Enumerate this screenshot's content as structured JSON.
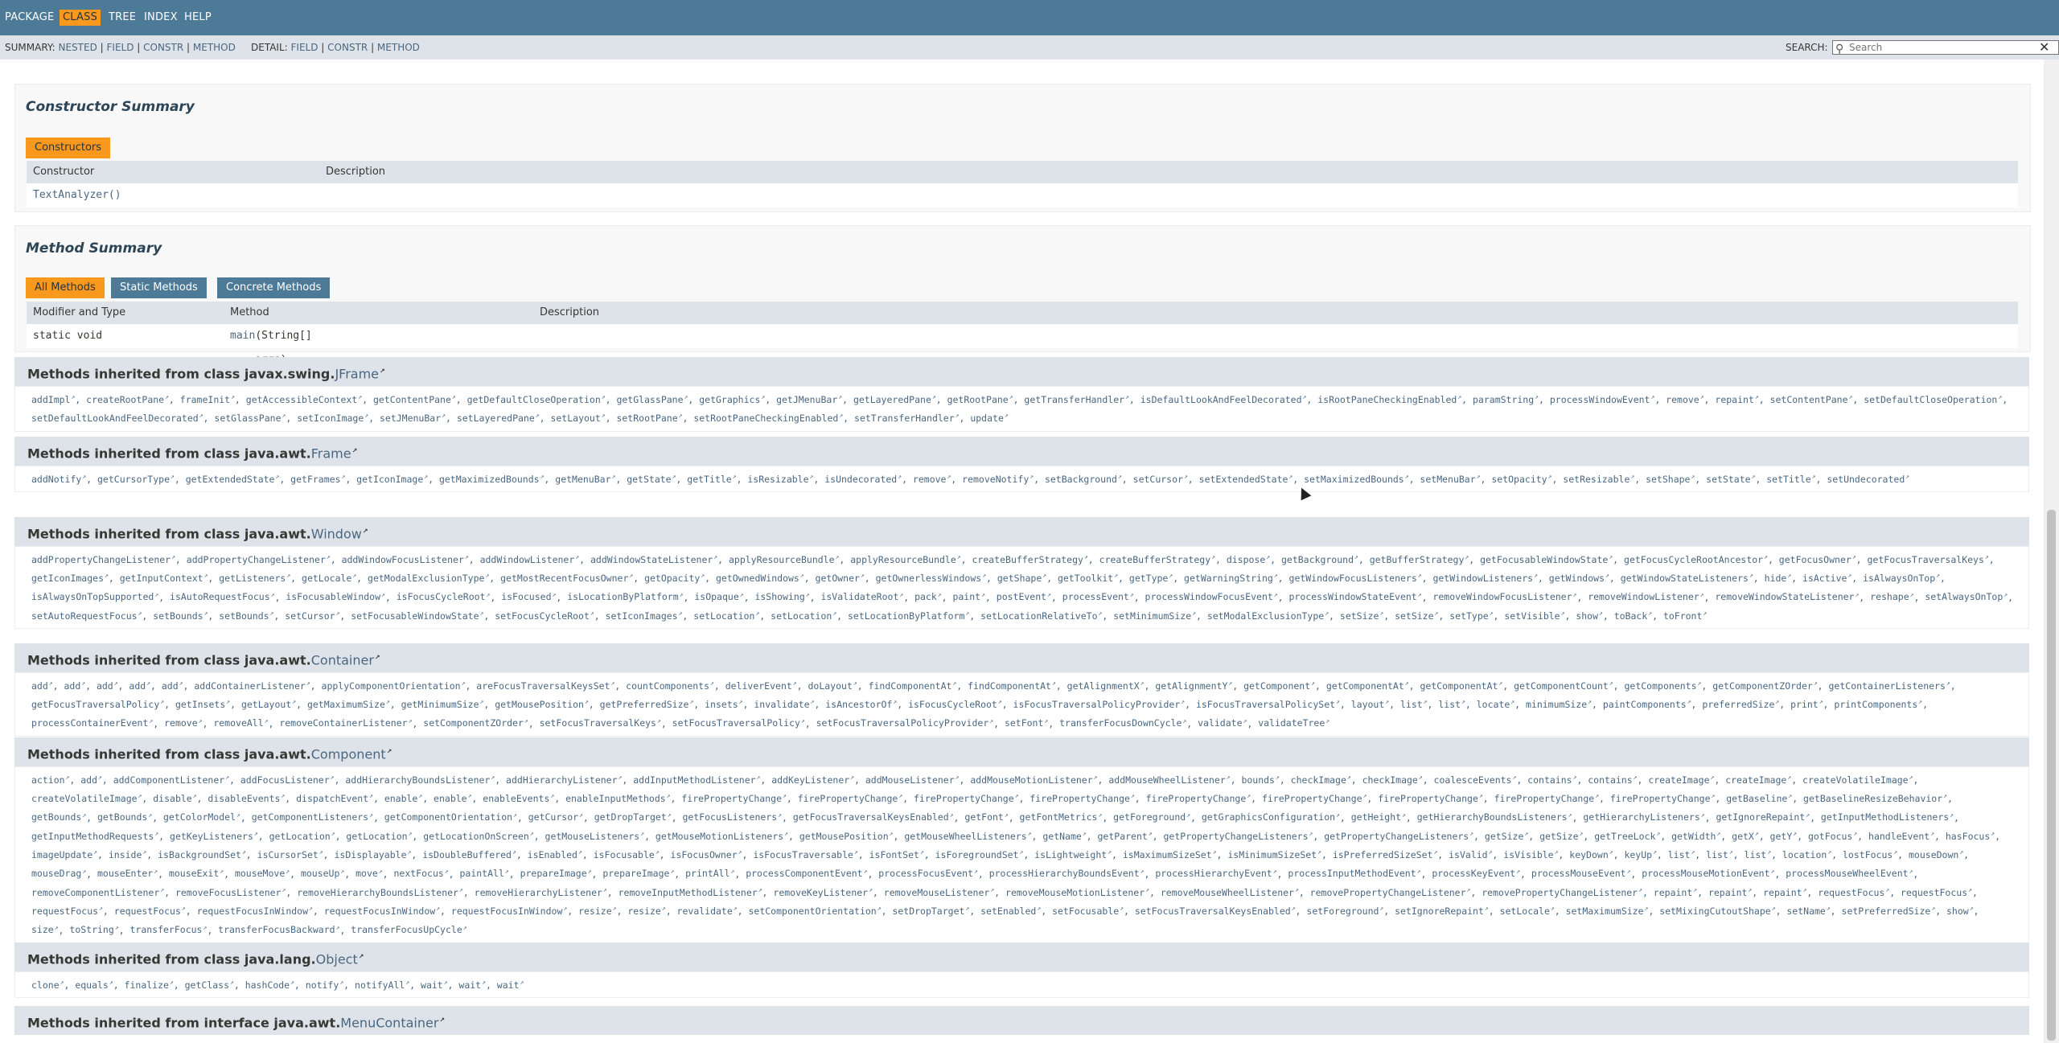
{
  "topnav": {
    "items": [
      "PACKAGE",
      "CLASS",
      "TREE",
      "INDEX",
      "HELP"
    ],
    "active": "CLASS"
  },
  "subnav": {
    "summary_label": "SUMMARY:",
    "summary_items": [
      "NESTED",
      "FIELD",
      "CONSTR",
      "METHOD"
    ],
    "detail_label": "DETAIL:",
    "detail_items": [
      "FIELD",
      "CONSTR",
      "METHOD"
    ],
    "search_label": "SEARCH:",
    "search_placeholder": "Search"
  },
  "constructor_summary": {
    "title": "Constructor Summary",
    "tab": "Constructors",
    "col_constructor": "Constructor",
    "col_description": "Description",
    "row_constructor": "TextAnalyzer()"
  },
  "method_summary": {
    "title": "Method Summary",
    "tabs": [
      "All Methods",
      "Static Methods",
      "Concrete Methods"
    ],
    "col_modifier": "Modifier and Type",
    "col_method": "Method",
    "col_description": "Description",
    "row_modifier": "static void",
    "row_method_name": "main",
    "row_method_params": "(String[] args)"
  },
  "inherited": [
    {
      "prefix": "Methods inherited from class javax.swing.",
      "cls": "JFrame",
      "methods": [
        "addImpl",
        "createRootPane",
        "frameInit",
        "getAccessibleContext",
        "getContentPane",
        "getDefaultCloseOperation",
        "getGlassPane",
        "getGraphics",
        "getJMenuBar",
        "getLayeredPane",
        "getRootPane",
        "getTransferHandler",
        "isDefaultLookAndFeelDecorated",
        "isRootPaneCheckingEnabled",
        "paramString",
        "processWindowEvent",
        "remove",
        "repaint",
        "setContentPane",
        "setDefaultCloseOperation",
        "setDefaultLookAndFeelDecorated",
        "setGlassPane",
        "setIconImage",
        "setJMenuBar",
        "setLayeredPane",
        "setLayout",
        "setRootPane",
        "setRootPaneCheckingEnabled",
        "setTransferHandler",
        "update"
      ]
    },
    {
      "prefix": "Methods inherited from class java.awt.",
      "cls": "Frame",
      "methods": [
        "addNotify",
        "getCursorType",
        "getExtendedState",
        "getFrames",
        "getIconImage",
        "getMaximizedBounds",
        "getMenuBar",
        "getState",
        "getTitle",
        "isResizable",
        "isUndecorated",
        "remove",
        "removeNotify",
        "setBackground",
        "setCursor",
        "setExtendedState",
        "setMaximizedBounds",
        "setMenuBar",
        "setOpacity",
        "setResizable",
        "setShape",
        "setState",
        "setTitle",
        "setUndecorated"
      ]
    },
    {
      "prefix": "Methods inherited from class java.awt.",
      "cls": "Window",
      "methods": [
        "addPropertyChangeListener",
        "addPropertyChangeListener",
        "addWindowFocusListener",
        "addWindowListener",
        "addWindowStateListener",
        "applyResourceBundle",
        "applyResourceBundle",
        "createBufferStrategy",
        "createBufferStrategy",
        "dispose",
        "getBackground",
        "getBufferStrategy",
        "getFocusableWindowState",
        "getFocusCycleRootAncestor",
        "getFocusOwner",
        "getFocusTraversalKeys",
        "getIconImages",
        "getInputContext",
        "getListeners",
        "getLocale",
        "getModalExclusionType",
        "getMostRecentFocusOwner",
        "getOpacity",
        "getOwnedWindows",
        "getOwner",
        "getOwnerlessWindows",
        "getShape",
        "getToolkit",
        "getType",
        "getWarningString",
        "getWindowFocusListeners",
        "getWindowListeners",
        "getWindows",
        "getWindowStateListeners",
        "hide",
        "isActive",
        "isAlwaysOnTop",
        "isAlwaysOnTopSupported",
        "isAutoRequestFocus",
        "isFocusableWindow",
        "isFocusCycleRoot",
        "isFocused",
        "isLocationByPlatform",
        "isOpaque",
        "isShowing",
        "isValidateRoot",
        "pack",
        "paint",
        "postEvent",
        "processEvent",
        "processWindowFocusEvent",
        "processWindowStateEvent",
        "removeWindowFocusListener",
        "removeWindowListener",
        "removeWindowStateListener",
        "reshape",
        "setAlwaysOnTop",
        "setAutoRequestFocus",
        "setBounds",
        "setBounds",
        "setCursor",
        "setFocusableWindowState",
        "setFocusCycleRoot",
        "setIconImages",
        "setLocation",
        "setLocation",
        "setLocationByPlatform",
        "setLocationRelativeTo",
        "setMinimumSize",
        "setModalExclusionType",
        "setSize",
        "setSize",
        "setType",
        "setVisible",
        "show",
        "toBack",
        "toFront"
      ]
    },
    {
      "prefix": "Methods inherited from class java.awt.",
      "cls": "Container",
      "methods": [
        "add",
        "add",
        "add",
        "add",
        "add",
        "addContainerListener",
        "applyComponentOrientation",
        "areFocusTraversalKeysSet",
        "countComponents",
        "deliverEvent",
        "doLayout",
        "findComponentAt",
        "findComponentAt",
        "getAlignmentX",
        "getAlignmentY",
        "getComponent",
        "getComponentAt",
        "getComponentAt",
        "getComponentCount",
        "getComponents",
        "getComponentZOrder",
        "getContainerListeners",
        "getFocusTraversalPolicy",
        "getInsets",
        "getLayout",
        "getMaximumSize",
        "getMinimumSize",
        "getMousePosition",
        "getPreferredSize",
        "insets",
        "invalidate",
        "isAncestorOf",
        "isFocusCycleRoot",
        "isFocusTraversalPolicyProvider",
        "isFocusTraversalPolicySet",
        "layout",
        "list",
        "list",
        "locate",
        "minimumSize",
        "paintComponents",
        "preferredSize",
        "print",
        "printComponents",
        "processContainerEvent",
        "remove",
        "removeAll",
        "removeContainerListener",
        "setComponentZOrder",
        "setFocusTraversalKeys",
        "setFocusTraversalPolicy",
        "setFocusTraversalPolicyProvider",
        "setFont",
        "transferFocusDownCycle",
        "validate",
        "validateTree"
      ]
    },
    {
      "prefix": "Methods inherited from class java.awt.",
      "cls": "Component",
      "methods": [
        "action",
        "add",
        "addComponentListener",
        "addFocusListener",
        "addHierarchyBoundsListener",
        "addHierarchyListener",
        "addInputMethodListener",
        "addKeyListener",
        "addMouseListener",
        "addMouseMotionListener",
        "addMouseWheelListener",
        "bounds",
        "checkImage",
        "checkImage",
        "coalesceEvents",
        "contains",
        "contains",
        "createImage",
        "createImage",
        "createVolatileImage",
        "createVolatileImage",
        "disable",
        "disableEvents",
        "dispatchEvent",
        "enable",
        "enable",
        "enableEvents",
        "enableInputMethods",
        "firePropertyChange",
        "firePropertyChange",
        "firePropertyChange",
        "firePropertyChange",
        "firePropertyChange",
        "firePropertyChange",
        "firePropertyChange",
        "firePropertyChange",
        "firePropertyChange",
        "getBaseline",
        "getBaselineResizeBehavior",
        "getBounds",
        "getBounds",
        "getColorModel",
        "getComponentListeners",
        "getComponentOrientation",
        "getCursor",
        "getDropTarget",
        "getFocusListeners",
        "getFocusTraversalKeysEnabled",
        "getFont",
        "getFontMetrics",
        "getForeground",
        "getGraphicsConfiguration",
        "getHeight",
        "getHierarchyBoundsListeners",
        "getHierarchyListeners",
        "getIgnoreRepaint",
        "getInputMethodListeners",
        "getInputMethodRequests",
        "getKeyListeners",
        "getLocation",
        "getLocation",
        "getLocationOnScreen",
        "getMouseListeners",
        "getMouseMotionListeners",
        "getMousePosition",
        "getMouseWheelListeners",
        "getName",
        "getParent",
        "getPropertyChangeListeners",
        "getPropertyChangeListeners",
        "getSize",
        "getSize",
        "getTreeLock",
        "getWidth",
        "getX",
        "getY",
        "gotFocus",
        "handleEvent",
        "hasFocus",
        "imageUpdate",
        "inside",
        "isBackgroundSet",
        "isCursorSet",
        "isDisplayable",
        "isDoubleBuffered",
        "isEnabled",
        "isFocusable",
        "isFocusOwner",
        "isFocusTraversable",
        "isFontSet",
        "isForegroundSet",
        "isLightweight",
        "isMaximumSizeSet",
        "isMinimumSizeSet",
        "isPreferredSizeSet",
        "isValid",
        "isVisible",
        "keyDown",
        "keyUp",
        "list",
        "list",
        "list",
        "location",
        "lostFocus",
        "mouseDown",
        "mouseDrag",
        "mouseEnter",
        "mouseExit",
        "mouseMove",
        "mouseUp",
        "move",
        "nextFocus",
        "paintAll",
        "prepareImage",
        "prepareImage",
        "printAll",
        "processComponentEvent",
        "processFocusEvent",
        "processHierarchyBoundsEvent",
        "processHierarchyEvent",
        "processInputMethodEvent",
        "processKeyEvent",
        "processMouseEvent",
        "processMouseMotionEvent",
        "processMouseWheelEvent",
        "removeComponentListener",
        "removeFocusListener",
        "removeHierarchyBoundsListener",
        "removeHierarchyListener",
        "removeInputMethodListener",
        "removeKeyListener",
        "removeMouseListener",
        "removeMouseMotionListener",
        "removeMouseWheelListener",
        "removePropertyChangeListener",
        "removePropertyChangeListener",
        "repaint",
        "repaint",
        "repaint",
        "requestFocus",
        "requestFocus",
        "requestFocus",
        "requestFocus",
        "requestFocusInWindow",
        "requestFocusInWindow",
        "requestFocusInWindow",
        "resize",
        "resize",
        "revalidate",
        "setComponentOrientation",
        "setDropTarget",
        "setEnabled",
        "setFocusable",
        "setFocusTraversalKeysEnabled",
        "setForeground",
        "setIgnoreRepaint",
        "setLocale",
        "setMaximumSize",
        "setMixingCutoutShape",
        "setName",
        "setPreferredSize",
        "show",
        "size",
        "toString",
        "transferFocus",
        "transferFocusBackward",
        "transferFocusUpCycle"
      ]
    },
    {
      "prefix": "Methods inherited from class java.lang.",
      "cls": "Object",
      "methods": [
        "clone",
        "equals",
        "finalize",
        "getClass",
        "hashCode",
        "notify",
        "notifyAll",
        "wait",
        "wait",
        "wait"
      ]
    },
    {
      "prefix": "Methods inherited from interface java.awt.",
      "cls": "MenuContainer",
      "methods": []
    }
  ],
  "colors": {
    "nav_bg": "#4d7a97",
    "active_orange": "#f8981d",
    "link_blue": "#4a6782",
    "header_gray": "#dee3e9"
  }
}
